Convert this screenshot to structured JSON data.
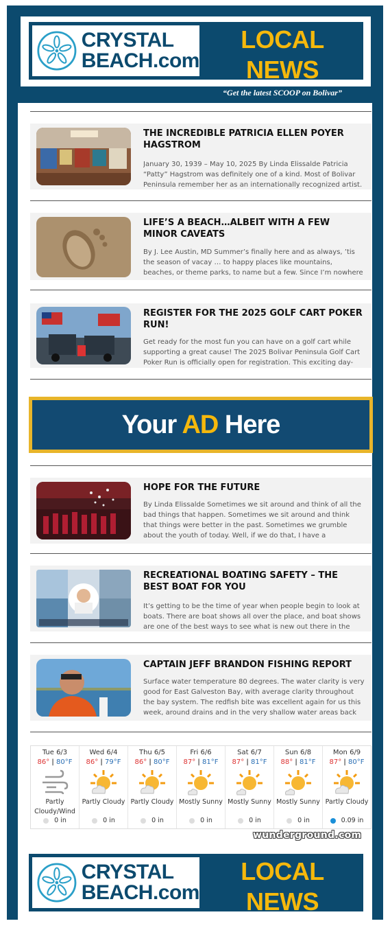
{
  "header": {
    "logo_line1": "CRYSTAL",
    "logo_line2": "BEACH.com",
    "title": "LOCAL NEWS",
    "tagline": "“Get the latest SCOOP on Bolivar”"
  },
  "stories": [
    {
      "title": "THE INCREDIBLE PATRICIA ELLEN POYER HAGSTROM",
      "excerpt": "January 30, 1939 – May 10, 2025 By Linda Elissalde Patricia “Patty” Hagstrom was definitely one of a kind. Most of Bolivar Peninsula remember her as an internationally recognized artist.",
      "image": "art-gallery-photo"
    },
    {
      "title": "LIFE’S A BEACH…ALBEIT WITH A FEW MINOR CAVEATS",
      "excerpt": "By J. Lee Austin, MD Summer’s finally here and as always, ’tis the season of vacay … to happy places like mountains, beaches, or theme parks, to name but a few. Since I’m nowhere near the",
      "image": "footprint-in-sand-photo"
    },
    {
      "title": "REGISTER FOR THE 2025 GOLF CART POKER RUN!",
      "excerpt": "Get ready for the most fun you can have on a golf cart while supporting a great cause! The 2025 Bolivar Peninsula Golf Cart Poker Run is officially open for registration. This exciting day-",
      "image": "golf-carts-flags-photo"
    },
    {
      "title": "HOPE FOR THE FUTURE",
      "excerpt": "By Linda Elissalde Sometimes we sit around and think of all the bad things that happen. Sometimes we sit around and think that things were better in the past. Sometimes we grumble about the youth of today. Well, if we do that, I have a",
      "image": "graduation-photo"
    },
    {
      "title": "RECREATIONAL BOATING SAFETY – THE BEST BOAT FOR YOU",
      "excerpt": "It’s getting to be the time of year when people begin to look at boats. There are boat shows all over the place, and boat shows are one of the best ways to see what is new out there in the",
      "image": "boating-collage-photo"
    },
    {
      "title": "CAPTAIN JEFF BRANDON FISHING REPORT",
      "excerpt": "Surface water temperature 80 degrees. The water clarity is very good for East Galveston Bay, with average clarity throughout the bay system. The redfish bite was excellent again for us this week, around drains and in the very shallow water areas back",
      "image": "fisherman-selfie-photo"
    }
  ],
  "ad": {
    "text_before": "Your ",
    "text_highlight": "AD",
    "text_after": " Here"
  },
  "weather": {
    "days": [
      {
        "name": "Tue 6/3",
        "hi": "86°",
        "lo": "80°F",
        "icon": "wind-cloud-icon",
        "condition": "Partly Cloudy/Wind",
        "precip": "0 in",
        "wet": false
      },
      {
        "name": "Wed 6/4",
        "hi": "86°",
        "lo": "79°F",
        "icon": "partly-cloudy-icon",
        "condition": "Partly Cloudy",
        "precip": "0 in",
        "wet": false
      },
      {
        "name": "Thu 6/5",
        "hi": "86°",
        "lo": "80°F",
        "icon": "partly-cloudy-icon",
        "condition": "Partly Cloudy",
        "precip": "0 in",
        "wet": false
      },
      {
        "name": "Fri 6/6",
        "hi": "87°",
        "lo": "81°F",
        "icon": "mostly-sunny-icon",
        "condition": "Mostly Sunny",
        "precip": "0 in",
        "wet": false
      },
      {
        "name": "Sat 6/7",
        "hi": "87°",
        "lo": "81°F",
        "icon": "mostly-sunny-icon",
        "condition": "Mostly Sunny",
        "precip": "0 in",
        "wet": false
      },
      {
        "name": "Sun 6/8",
        "hi": "88°",
        "lo": "81°F",
        "icon": "mostly-sunny-icon",
        "condition": "Mostly Sunny",
        "precip": "0 in",
        "wet": false
      },
      {
        "name": "Mon 6/9",
        "hi": "87°",
        "lo": "80°F",
        "icon": "partly-cloudy-icon",
        "condition": "Partly Cloudy",
        "precip": "0.09 in",
        "wet": true
      }
    ],
    "credit": "wunderground.com"
  },
  "colors": {
    "brand_navy": "#0c4a6e",
    "brand_gold": "#f5b80c",
    "high_temp": "#dd3333",
    "low_temp": "#2a6fb5"
  }
}
